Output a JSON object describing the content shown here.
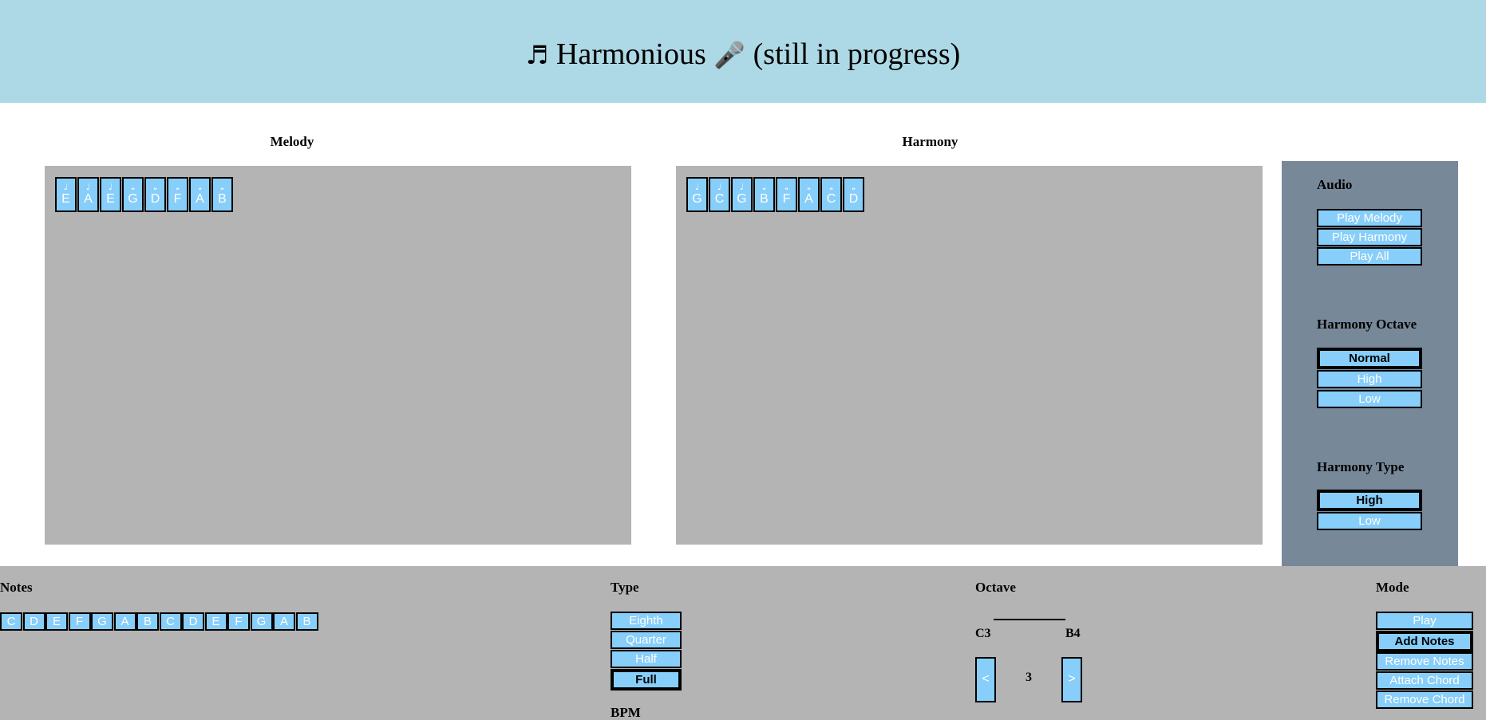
{
  "header": {
    "note_glyph": "♬",
    "title": "Harmonious",
    "mic_glyph": "🎤",
    "subtitle": "(still in progress)"
  },
  "melody": {
    "title": "Melody",
    "notes": [
      {
        "symbol": "♩",
        "name": "E"
      },
      {
        "symbol": "♩",
        "name": "A"
      },
      {
        "symbol": "♩",
        "name": "E"
      },
      {
        "symbol": "𝅝",
        "name": "G"
      },
      {
        "symbol": "𝅝",
        "name": "D"
      },
      {
        "symbol": "𝅝",
        "name": "F"
      },
      {
        "symbol": "𝅝",
        "name": "A"
      },
      {
        "symbol": "𝅝",
        "name": "B"
      }
    ]
  },
  "harmony": {
    "title": "Harmony",
    "notes": [
      {
        "symbol": "♩",
        "name": "G"
      },
      {
        "symbol": "♩",
        "name": "C"
      },
      {
        "symbol": "♩",
        "name": "G"
      },
      {
        "symbol": "𝅝",
        "name": "B"
      },
      {
        "symbol": "𝅝",
        "name": "F"
      },
      {
        "symbol": "𝅝",
        "name": "A"
      },
      {
        "symbol": "𝅝",
        "name": "C"
      },
      {
        "symbol": "𝅝",
        "name": "D"
      }
    ]
  },
  "side_panel": {
    "audio": {
      "title": "Audio",
      "buttons": [
        "Play Melody",
        "Play Harmony",
        "Play All"
      ]
    },
    "harmony_octave": {
      "title": "Harmony Octave",
      "options": [
        "Normal",
        "High",
        "Low"
      ],
      "selected": "Normal"
    },
    "harmony_type": {
      "title": "Harmony Type",
      "options": [
        "High",
        "Low"
      ],
      "selected": "High"
    }
  },
  "bottom": {
    "notes": {
      "title": "Notes",
      "keys": [
        "C",
        "D",
        "E",
        "F",
        "G",
        "A",
        "B",
        "C",
        "D",
        "E",
        "F",
        "G",
        "A",
        "B"
      ]
    },
    "type": {
      "title": "Type",
      "options": [
        "Eighth",
        "Quarter",
        "Half",
        "Full"
      ],
      "selected": "Full",
      "bpm_label": "BPM"
    },
    "octave": {
      "title": "Octave",
      "low": "C3",
      "high": "B4",
      "prev_label": "<",
      "next_label": ">",
      "value": "3"
    },
    "mode": {
      "title": "Mode",
      "options": [
        "Play",
        "Add Notes",
        "Remove Notes",
        "Attach Chord",
        "Remove Chord"
      ],
      "selected": "Add Notes"
    }
  },
  "colors": {
    "header_bg": "#add8e6",
    "panel_bg": "#778899",
    "staff_bg": "#b4b4b4",
    "button_bg": "#87cefa"
  }
}
